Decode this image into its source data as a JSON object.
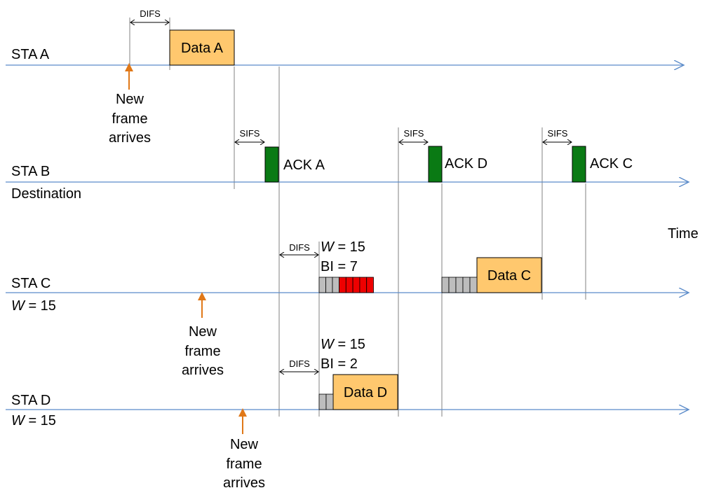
{
  "stations": {
    "a": {
      "label": "STA A"
    },
    "b": {
      "label": "STA B",
      "sublabel": "Destination"
    },
    "c": {
      "label": "STA C",
      "w_var": "W",
      "w_value": " = 15"
    },
    "d": {
      "label": "STA D",
      "w_var": "W",
      "w_value": " = 15"
    }
  },
  "time_label": "Time",
  "frames": {
    "data_a": "Data A",
    "data_c": "Data C",
    "data_d": "Data D",
    "ack_a": "ACK A",
    "ack_d": "ACK D",
    "ack_c": "ACK C"
  },
  "intervals": {
    "difs_a": "DIFS",
    "sifs_1": "SIFS",
    "sifs_2": "SIFS",
    "sifs_3": "SIFS",
    "difs_c": "DIFS",
    "difs_d": "DIFS"
  },
  "backoff": {
    "c_w_var": "W",
    "c_w_value": " = 15",
    "c_bi": "BI = 7",
    "d_w_var": "W",
    "d_w_value": " = 15",
    "d_bi": "BI = 2"
  },
  "arrivals": {
    "a": [
      "New",
      "frame",
      "arrives"
    ],
    "c": [
      "New",
      "frame",
      "arrives"
    ],
    "d": [
      "New",
      "frame",
      "arrives"
    ]
  },
  "colors": {
    "timeline": "#5b8bc9",
    "data_fill": "#ffc86e",
    "ack_fill": "#0a7a14",
    "backoff_idle": "#bdbdbd",
    "backoff_active": "#ee0000",
    "arrow": "#e07818",
    "guide": "#808080"
  }
}
